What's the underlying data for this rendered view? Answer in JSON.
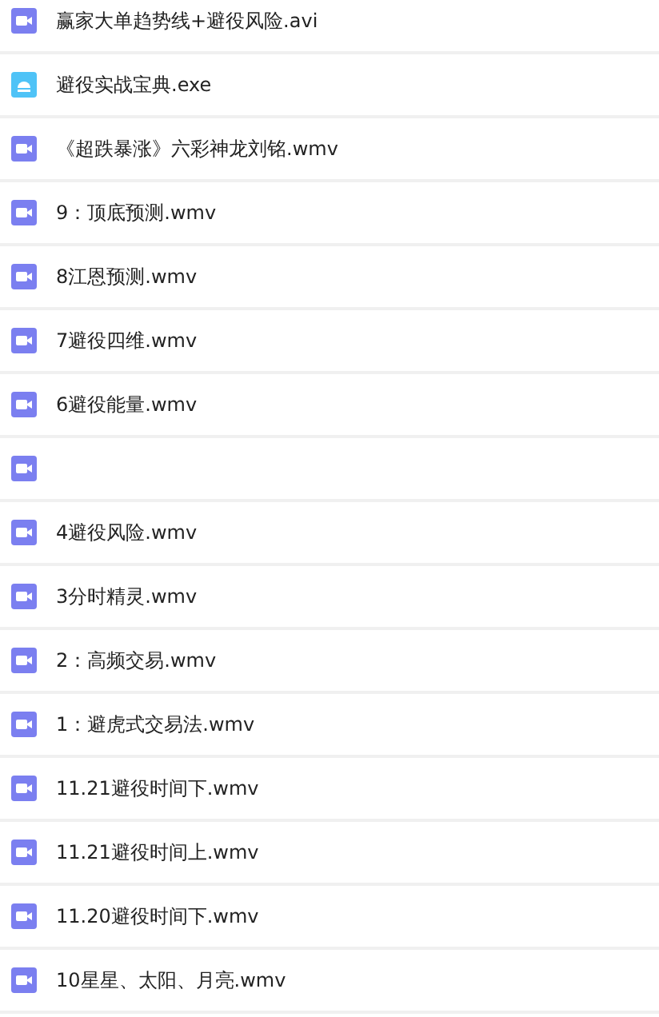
{
  "files": [
    {
      "kind": "video",
      "name": "赢家大单趋势线+避役风险.avi"
    },
    {
      "kind": "exe",
      "name": "避役实战宝典.exe"
    },
    {
      "kind": "video",
      "name": "《超跌暴涨》六彩神龙刘铭.wmv"
    },
    {
      "kind": "video",
      "name": "9：顶底预测.wmv"
    },
    {
      "kind": "video",
      "name": "8江恩预测.wmv"
    },
    {
      "kind": "video",
      "name": "7避役四维.wmv"
    },
    {
      "kind": "video",
      "name": "6避役能量.wmv"
    },
    {
      "kind": "video"
    },
    {
      "kind": "video",
      "name": "4避役风险.wmv"
    },
    {
      "kind": "video",
      "name": "3分时精灵.wmv"
    },
    {
      "kind": "video",
      "name": "2：高频交易.wmv"
    },
    {
      "kind": "video",
      "name": "1：避虎式交易法.wmv"
    },
    {
      "kind": "video",
      "name": "11.21避役时间下.wmv"
    },
    {
      "kind": "video",
      "name": "11.21避役时间上.wmv"
    },
    {
      "kind": "video",
      "name": "11.20避役时间下.wmv"
    },
    {
      "kind": "video",
      "name": "10星星、太阳、月亮.wmv"
    }
  ]
}
